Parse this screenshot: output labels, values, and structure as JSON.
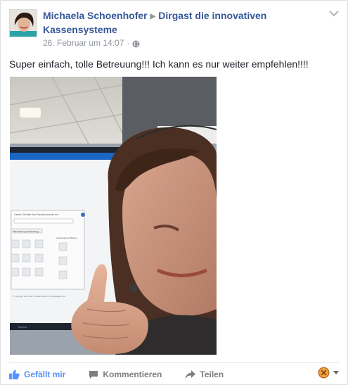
{
  "post": {
    "author": "Michaela Schoenhofer",
    "target": "Dirgast die innovativen Kassensysteme",
    "timestamp": "26. Februar um 14:07",
    "dot": "·",
    "text": "Super einfach, tolle Betreuung!!! Ich kann es nur weiter empfehlen!!!!"
  },
  "screen_in_photo": {
    "dialog_prompt": "Geben Sie bitte Ihre Kundennummer ein:",
    "dropdown_value": "Bar-Zahlung (Sonderbeleg)",
    "field_label": "eingetragenen Betrag:",
    "footer": "© Copyright 2017 Elek. Christian Wenzel, office@digast.com",
    "monitor_brand": "Ilyama"
  },
  "actions": {
    "like": "Gefällt mir",
    "comment": "Kommentieren",
    "share": "Teilen"
  },
  "colors": {
    "link": "#365899",
    "meta": "#90949c",
    "like": "#5890ff",
    "action": "#7f7f7f"
  }
}
